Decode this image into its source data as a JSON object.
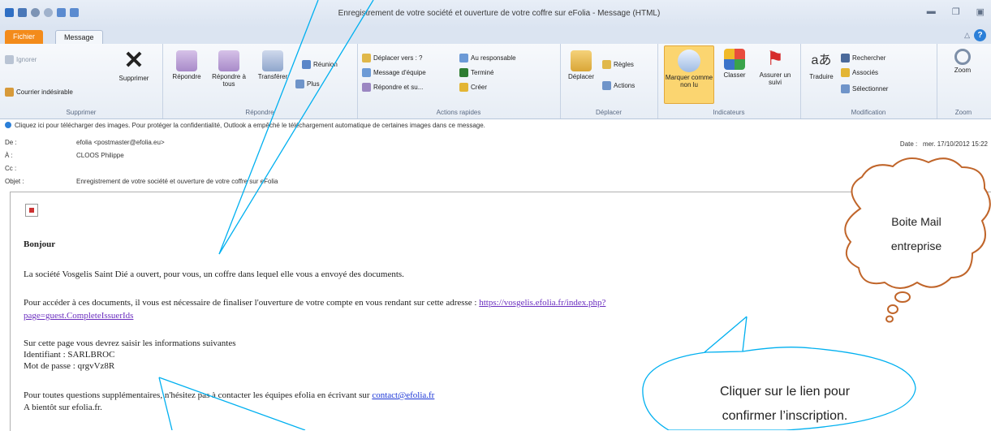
{
  "window": {
    "title": "Enregistrement de votre société et ouverture de votre coffre sur eFolia - Message (HTML)"
  },
  "tabs": {
    "file": "Fichier",
    "message": "Message"
  },
  "ribbon": {
    "supprimer": {
      "ignorer": "Ignorer",
      "courrier": "Courrier indésirable",
      "supprimer": "Supprimer",
      "label": "Supprimer"
    },
    "repondre": {
      "repondre": "Répondre",
      "repondre_tous": "Répondre à tous",
      "transferer": "Transférer",
      "reunion": "Réunion",
      "plus": "Plus",
      "label": "Répondre"
    },
    "actions": {
      "deplacer_vers": "Déplacer vers : ?",
      "message_equipe": "Message d'équipe",
      "repondre_suppr": "Répondre et su...",
      "responsable": "Au responsable",
      "termine": "Terminé",
      "creer": "Créer",
      "label": "Actions rapides"
    },
    "deplacer": {
      "deplacer": "Déplacer",
      "regles": "Règles",
      "actions": "Actions",
      "label": "Déplacer"
    },
    "indicateurs": {
      "marquer": "Marquer comme non lu",
      "classer": "Classer",
      "assurer": "Assurer un suivi",
      "label": "Indicateurs"
    },
    "modification": {
      "traduire": "Traduire",
      "rechercher": "Rechercher",
      "associes": "Associés",
      "selectionner": "Sélectionner",
      "label": "Modification"
    },
    "zoom": {
      "zoom": "Zoom",
      "label": "Zoom"
    }
  },
  "header": {
    "info": "Cliquez ici pour télécharger des images. Pour protéger la confidentialité, Outlook a empêché le téléchargement automatique de certaines images dans ce message.",
    "from_label": "De :",
    "from": "efolia <postmaster@efolia.eu>",
    "to_label": "À :",
    "to": "CLOOS Philippe",
    "cc_label": "Cc :",
    "subject_label": "Objet :",
    "subject": "Enregistrement de votre société et ouverture de votre coffre sur eFolia",
    "date_label": "Date :",
    "date": "mer. 17/10/2012 15:22"
  },
  "body": {
    "greeting": "Bonjour",
    "p1": "La société Vosgelis Saint Dié a ouvert, pour vous, un coffre dans lequel elle vous a envoyé des documents.",
    "p2": "Pour accéder à ces documents, il vous est nécessaire de finaliser l'ouverture de votre compte en vous rendant sur cette adresse : ",
    "link1": "https://vosgelis.efolia.fr/index.php?",
    "link2": "page=guest.CompleteIssuerIds",
    "p3": "Sur cette page vous devrez saisir les informations suivantes",
    "ident": "Identifiant : SARLBROC",
    "pass": "Mot de passe : qrgvVz8R",
    "p4": "Pour toutes questions supplémentaires, n'hésitez pas à contacter les équipes efolia en écrivant sur ",
    "contact": "contact@efolia.fr",
    "p5": "A bientôt sur efolia.fr."
  },
  "callouts": {
    "cloud_line1": "Boite Mail",
    "cloud_line2": "entreprise",
    "oval_line1": "Cliquer sur le lien pour",
    "oval_line2": "confirmer l’inscription."
  },
  "colors": {
    "accent": "#00b0f0",
    "file_tab": "#f38b1b",
    "link": "#6a2dbf",
    "cloud_dot": "#c0652a"
  }
}
